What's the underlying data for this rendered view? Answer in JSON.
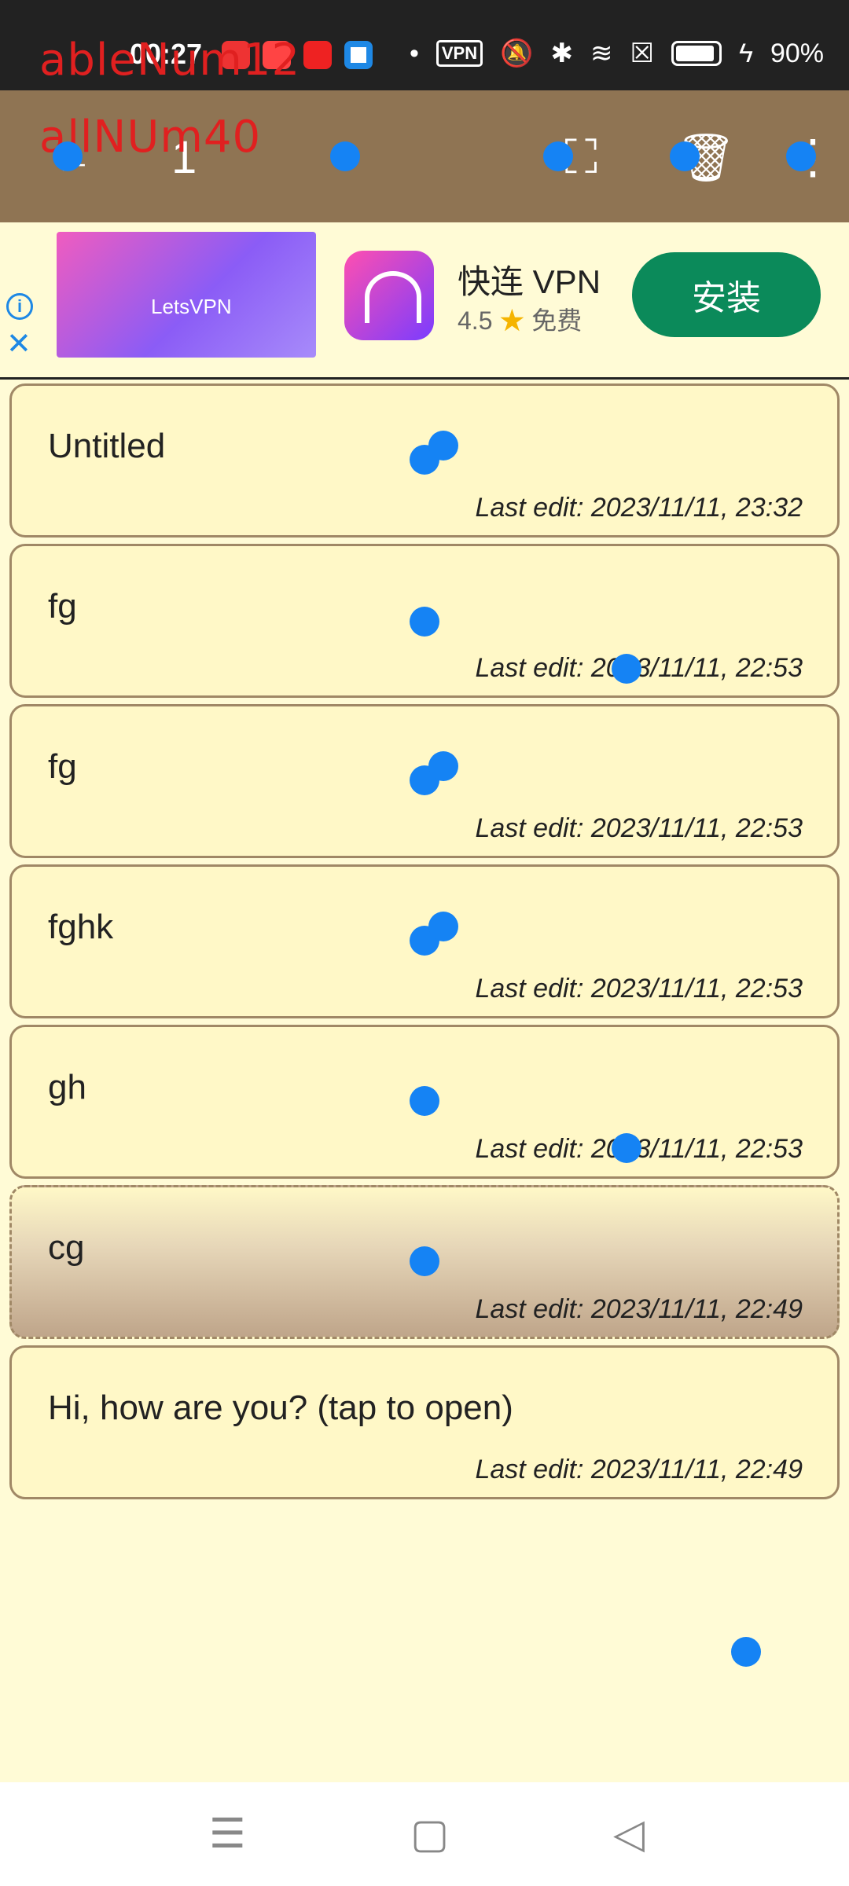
{
  "status_bar": {
    "time": "00:27",
    "vpn_badge": "VPN",
    "battery": "90%"
  },
  "overlay": {
    "line1": "ableNum12",
    "line2": "allNUm40"
  },
  "toolbar": {
    "selected_count": "1"
  },
  "ad": {
    "image_label": "LetsVPN",
    "app_name": "快连 VPN",
    "rating": "4.5",
    "price": "免费",
    "install_label": "安装"
  },
  "notes": [
    {
      "title": "Untitled",
      "last_edit": "Last edit: 2023/11/11, 23:32"
    },
    {
      "title": "fg",
      "last_edit": "Last edit: 2023/11/11, 22:53"
    },
    {
      "title": "fg",
      "last_edit": "Last edit: 2023/11/11, 22:53"
    },
    {
      "title": "fghk",
      "last_edit": "Last edit: 2023/11/11, 22:53"
    },
    {
      "title": "gh",
      "last_edit": "Last edit: 2023/11/11, 22:53"
    },
    {
      "title": "cg",
      "last_edit": "Last edit: 2023/11/11, 22:49"
    },
    {
      "title": "Hi, how are you? (tap to open)",
      "last_edit": "Last edit: 2023/11/11, 22:49"
    }
  ],
  "icons": {
    "back": "back-arrow-icon",
    "select_all": "select-all-icon",
    "delete": "trash-icon",
    "more": "more-vert-icon",
    "nav_menu": "menu-icon",
    "nav_home": "home-icon",
    "nav_back": "back-icon"
  },
  "colors": {
    "toolbar": "#8f7453",
    "background": "#fffbd6",
    "note_card": "#fff8c7",
    "install_button": "#0b8a5a",
    "touch_dot": "#1583f4"
  }
}
